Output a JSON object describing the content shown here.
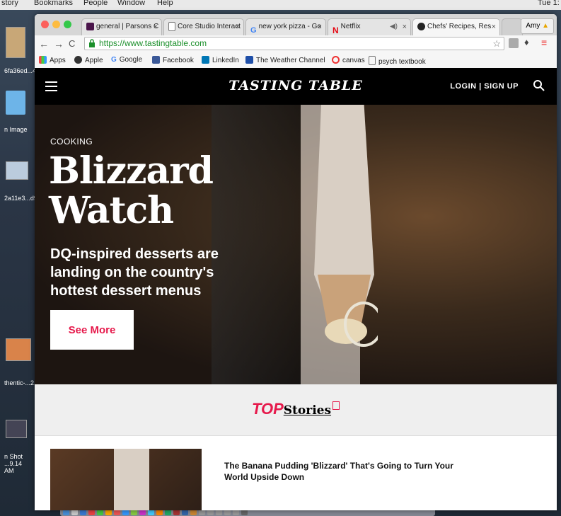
{
  "desktop": {
    "menubar": {
      "items": [
        "story",
        "Bookmarks",
        "People",
        "Window",
        "Help"
      ],
      "clock": "Tue 1:"
    },
    "icons": [
      "6fa36ed...4719",
      "n Image",
      "2a11e3...d9d...32",
      "thentic-...2.jpg",
      "n Shot ...9.14 AM"
    ]
  },
  "browser": {
    "tabs": [
      {
        "label": "general | Parsons C",
        "icon": "slack-icon"
      },
      {
        "label": "Core Studio Interact",
        "icon": "document-icon"
      },
      {
        "label": "new york pizza - Go",
        "icon": "google-icon"
      },
      {
        "label": "Netflix",
        "icon": "netflix-icon"
      },
      {
        "label": "Chefs' Recipes, Res",
        "icon": "tastingtable-icon"
      }
    ],
    "profile": "Amy",
    "url": "https://www.tastingtable.com",
    "bookmarks": [
      "Apps",
      "Apple",
      "Google",
      "Facebook",
      "LinkedIn",
      "The Weather Channel",
      "canvas",
      "psych textbook"
    ]
  },
  "site": {
    "logo": "TASTING TABLE",
    "login": "LOGIN | SIGN UP",
    "hero": {
      "category": "COOKING",
      "title": "Blizzard Watch",
      "subtitle": "DQ-inspired desserts are landing on the country's hottest dessert menus",
      "cta": "See More"
    },
    "top_stories": {
      "top": "TOP",
      "stories": "Stories"
    },
    "stories": [
      {
        "title": "The Banana Pudding 'Blizzard' That's Going to Turn Your World Upside Down"
      }
    ]
  },
  "colors": {
    "accent": "#e6194b",
    "header": "#000000"
  }
}
